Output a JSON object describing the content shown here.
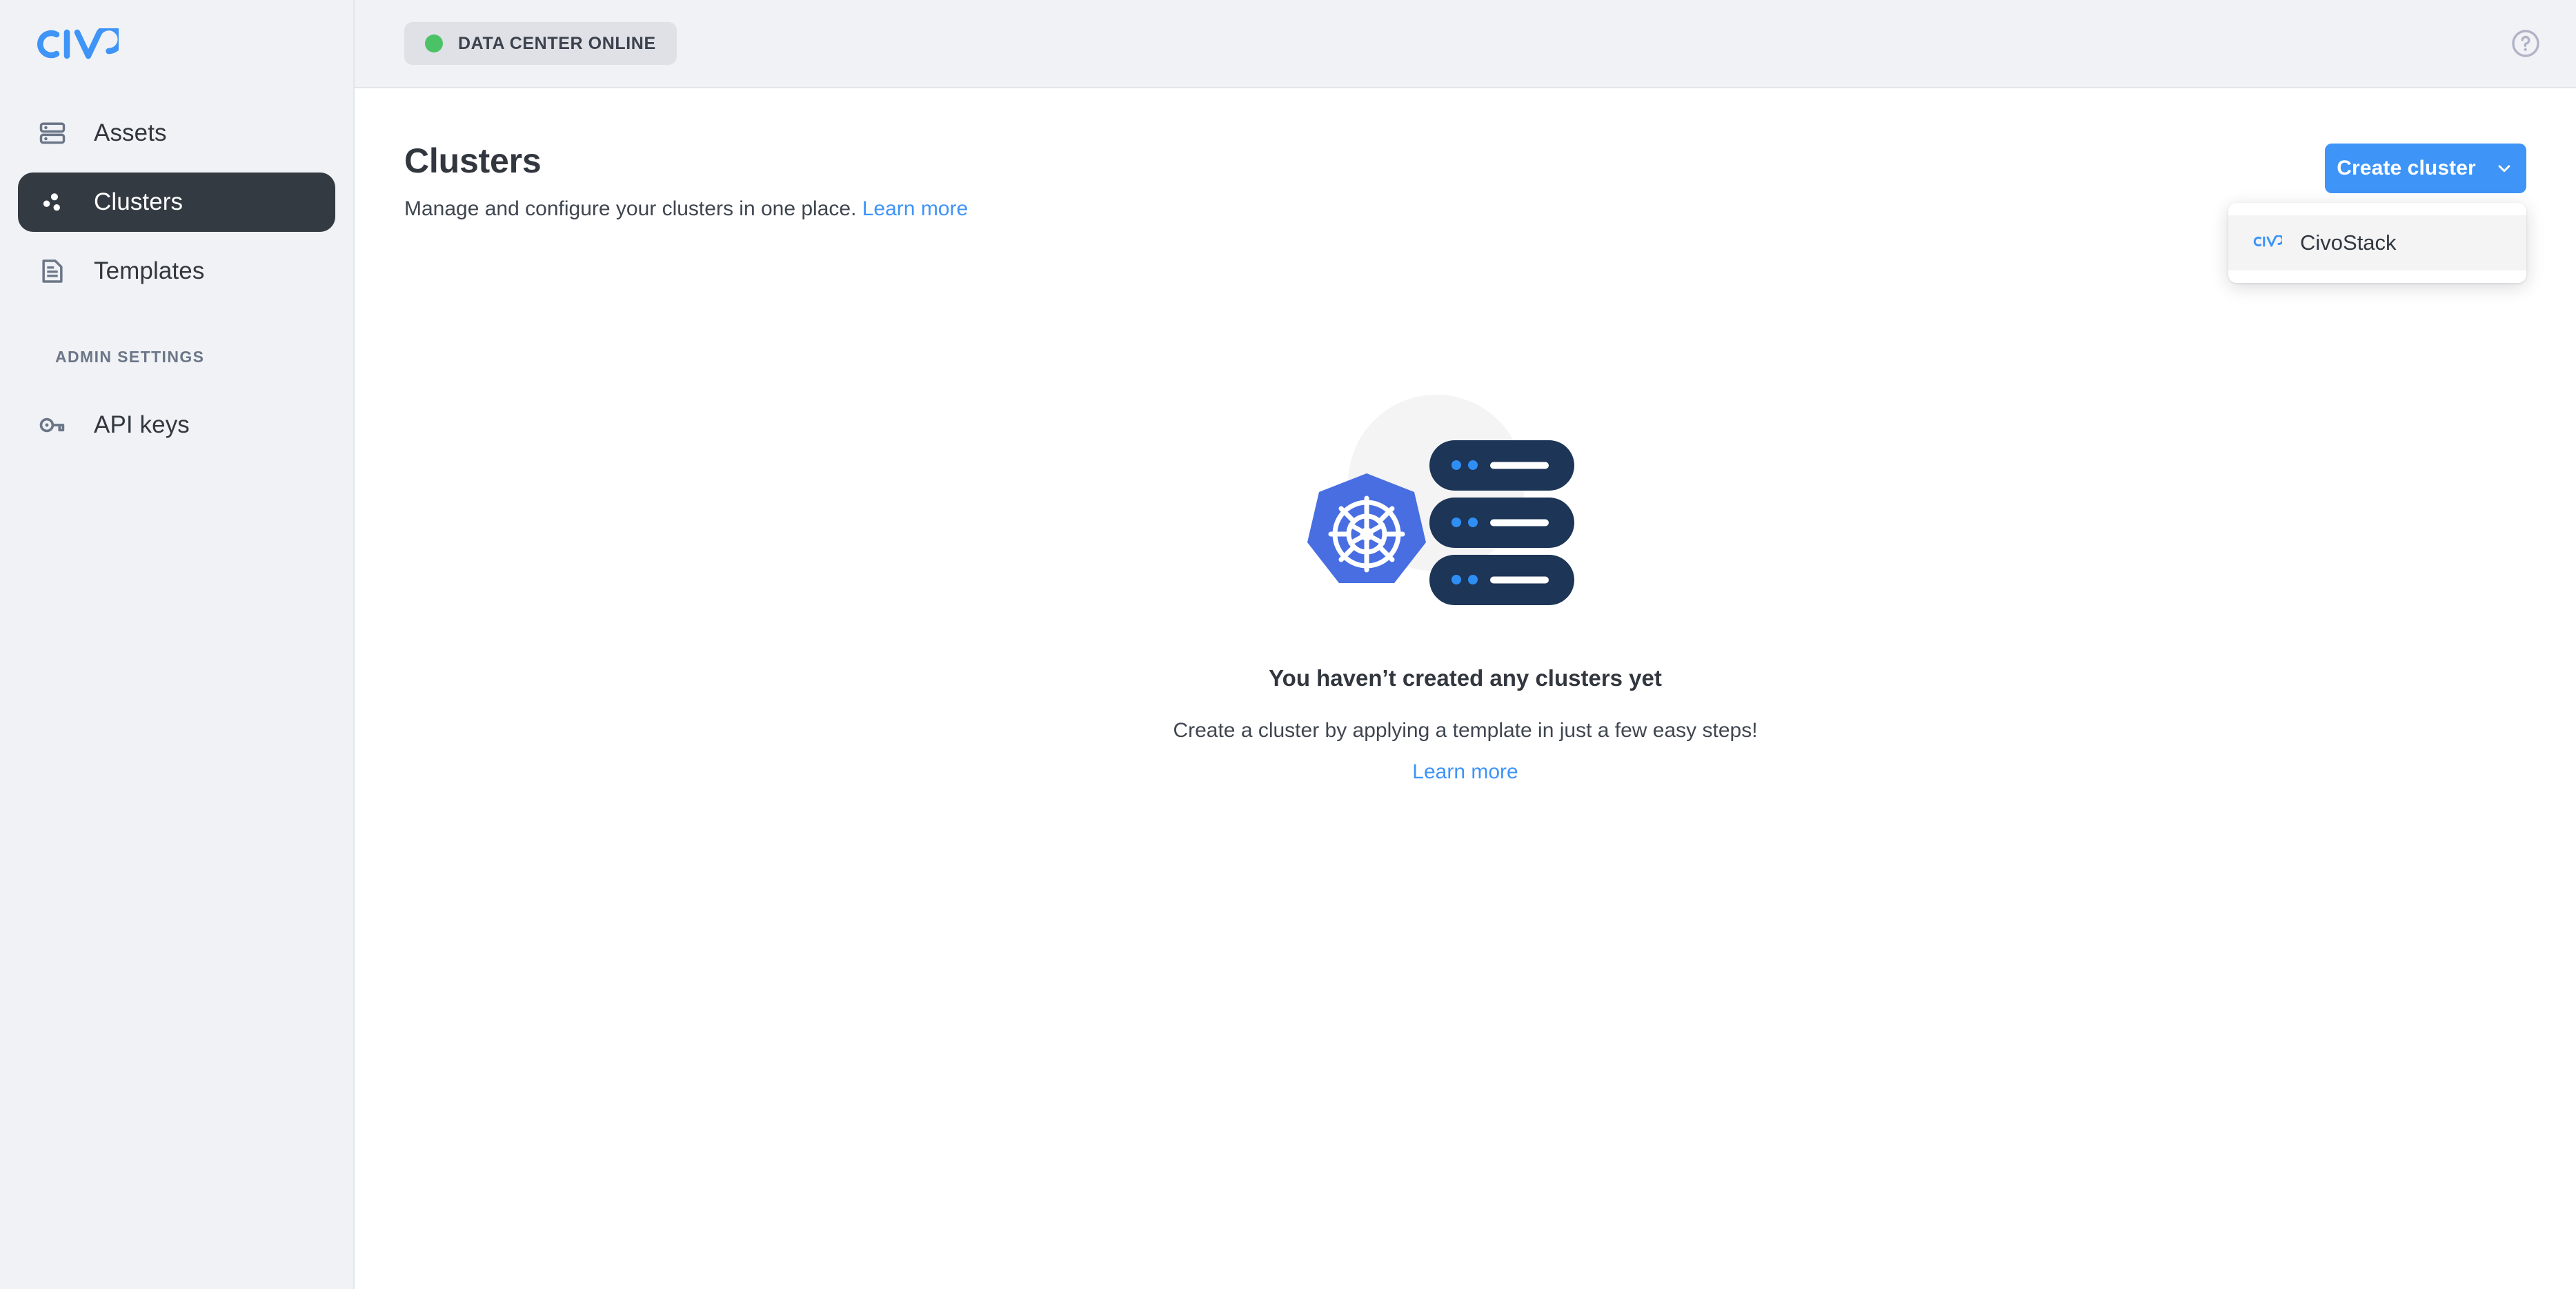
{
  "brand": {
    "logo_text": "CIVO",
    "accent_color": "#3e94f7",
    "sidebar_bg": "#f0f2f5",
    "active_nav_bg": "#343a42"
  },
  "sidebar": {
    "items": [
      {
        "label": "Assets",
        "icon": "server-rack-icon",
        "active": false
      },
      {
        "label": "Clusters",
        "icon": "clusters-dots-icon",
        "active": true
      },
      {
        "label": "Templates",
        "icon": "document-icon",
        "active": false
      }
    ],
    "section_title": "ADMIN SETTINGS",
    "admin_items": [
      {
        "label": "API keys",
        "icon": "key-icon",
        "active": false
      }
    ]
  },
  "topbar": {
    "status_badge": {
      "label": "DATA CENTER ONLINE",
      "dot_color": "#4cc267",
      "bg_color": "#dfe1e6"
    },
    "help_icon": "question-circle-icon"
  },
  "page": {
    "title": "Clusters",
    "subtitle": "Manage and configure your clusters in one place.",
    "subtitle_link": "Learn more"
  },
  "create_cluster": {
    "button_label": "Create cluster",
    "chevron_icon": "chevron-down-icon",
    "expanded": true,
    "menu_items": [
      {
        "label": "CivoStack",
        "icon": "civo-logo-icon",
        "hovered": true
      }
    ]
  },
  "empty_state": {
    "illustration": "kubernetes-servers-illustration",
    "title": "You haven’t created any clusters yet",
    "description": "Create a cluster by applying a template in just a few easy steps!",
    "link": "Learn more"
  }
}
